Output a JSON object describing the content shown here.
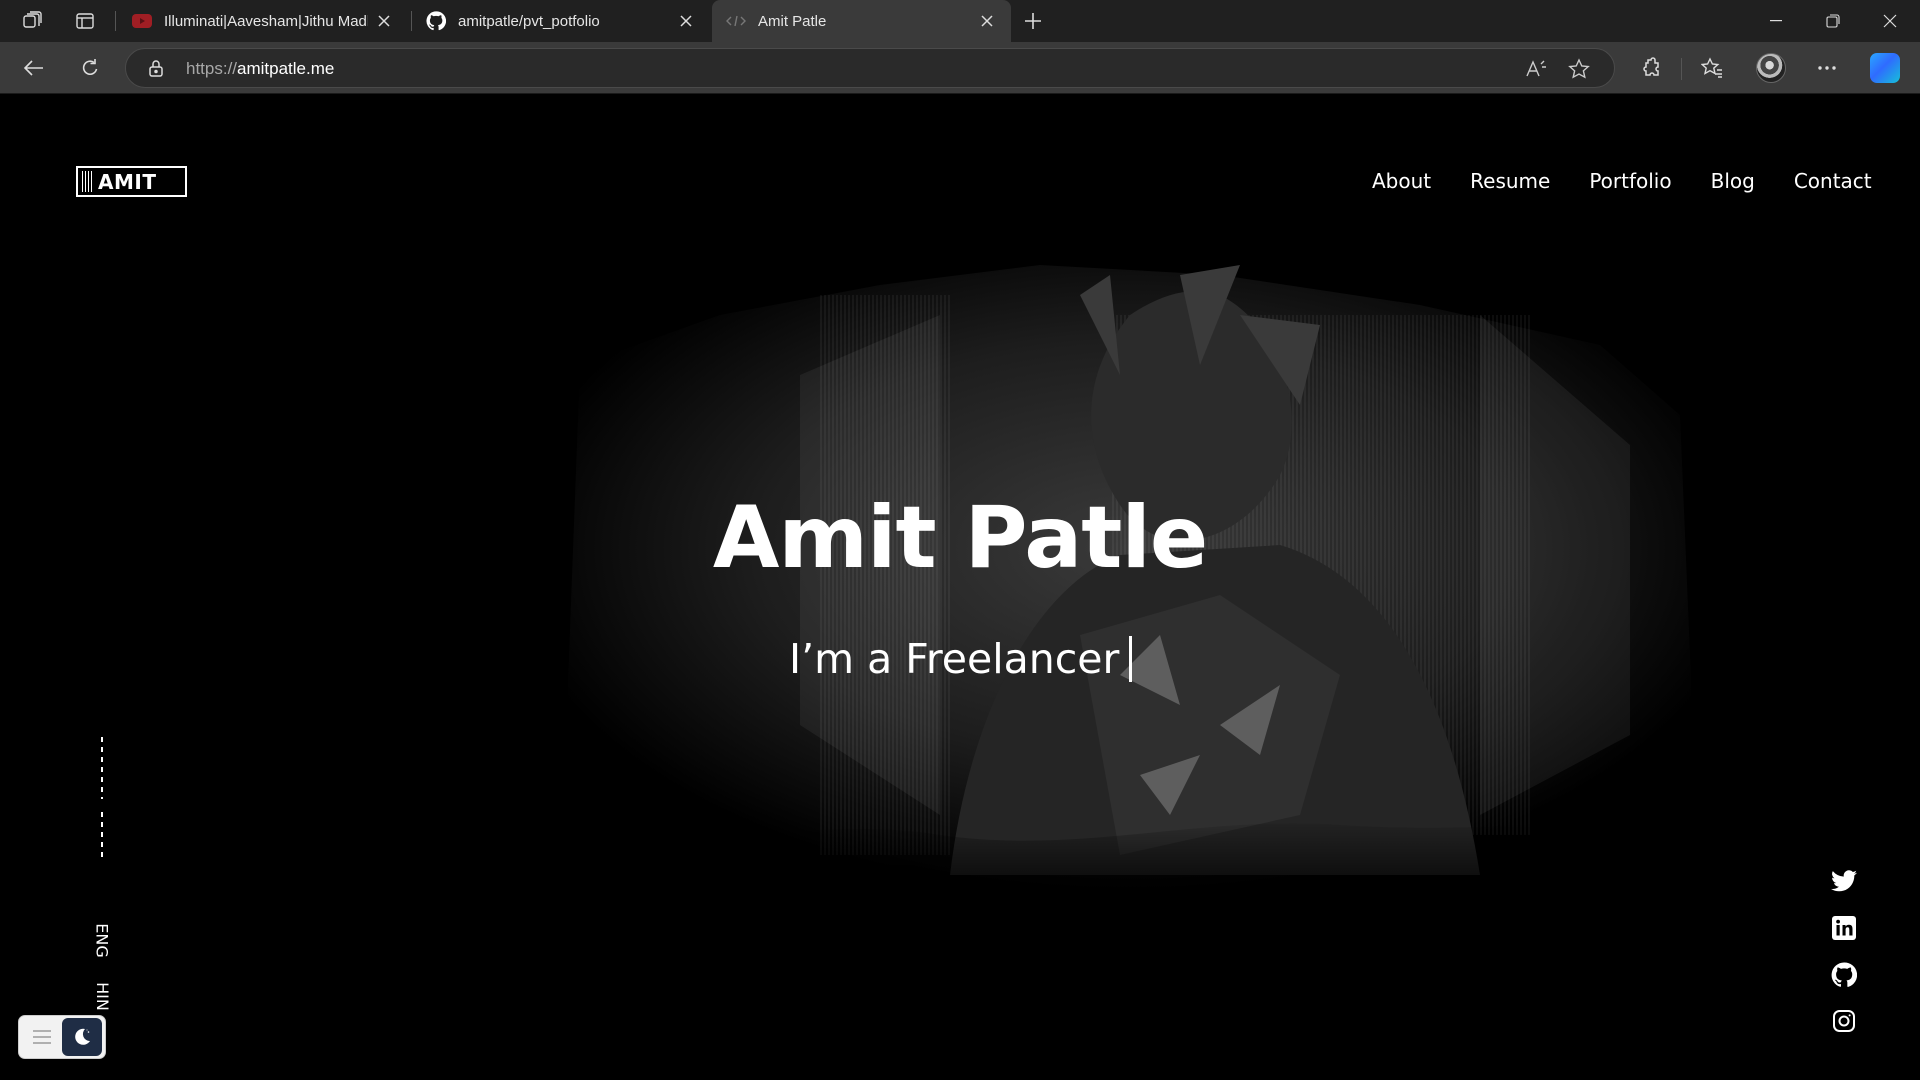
{
  "browser": {
    "tabs": [
      {
        "title": "Illuminati|Aavesham|Jithu Madhavan",
        "favicon": "youtube-icon",
        "active": false
      },
      {
        "title": "amitpatle/pvt_potfolio",
        "favicon": "github-icon",
        "active": false
      },
      {
        "title": "Amit Patle",
        "favicon": "code-icon",
        "active": true
      }
    ],
    "address": {
      "scheme": "https://",
      "host": "amitpatle.me"
    }
  },
  "site": {
    "logo_text": "AMIT",
    "nav": [
      "About",
      "Resume",
      "Portfolio",
      "Blog",
      "Contact"
    ],
    "hero": {
      "name": "Amit Patle",
      "role": "I’m a Freelancer"
    },
    "languages": [
      "ENG",
      "HIN"
    ],
    "social": [
      "twitter-icon",
      "linkedin-icon",
      "github-icon",
      "instagram-icon"
    ],
    "theme": "dark"
  },
  "colors": {
    "page_bg": "#000000",
    "text": "#ffffff",
    "tab_active": "#3a3a3a",
    "tabbar": "#202020"
  }
}
